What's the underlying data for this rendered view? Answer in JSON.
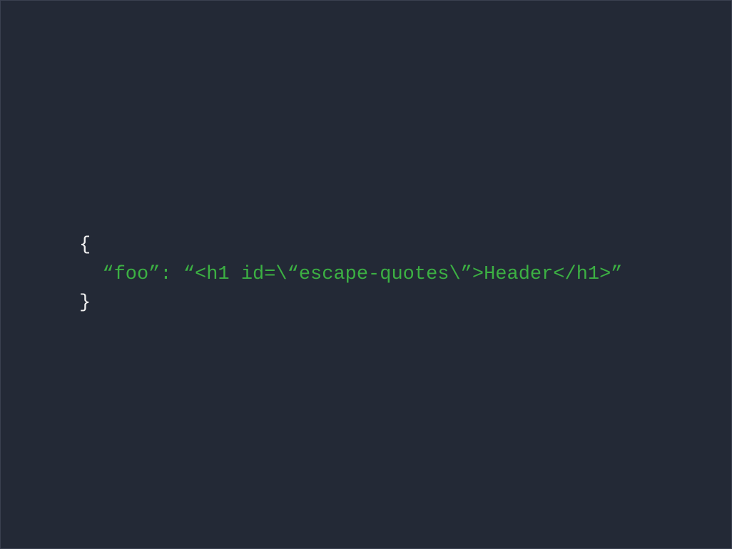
{
  "code": {
    "line1": "{",
    "line2_key": "“foo”",
    "line2_colon": ": ",
    "line2_value": "“<h1 id=\\“escape-quotes\\”>Header</h1>”",
    "line3": "}"
  }
}
